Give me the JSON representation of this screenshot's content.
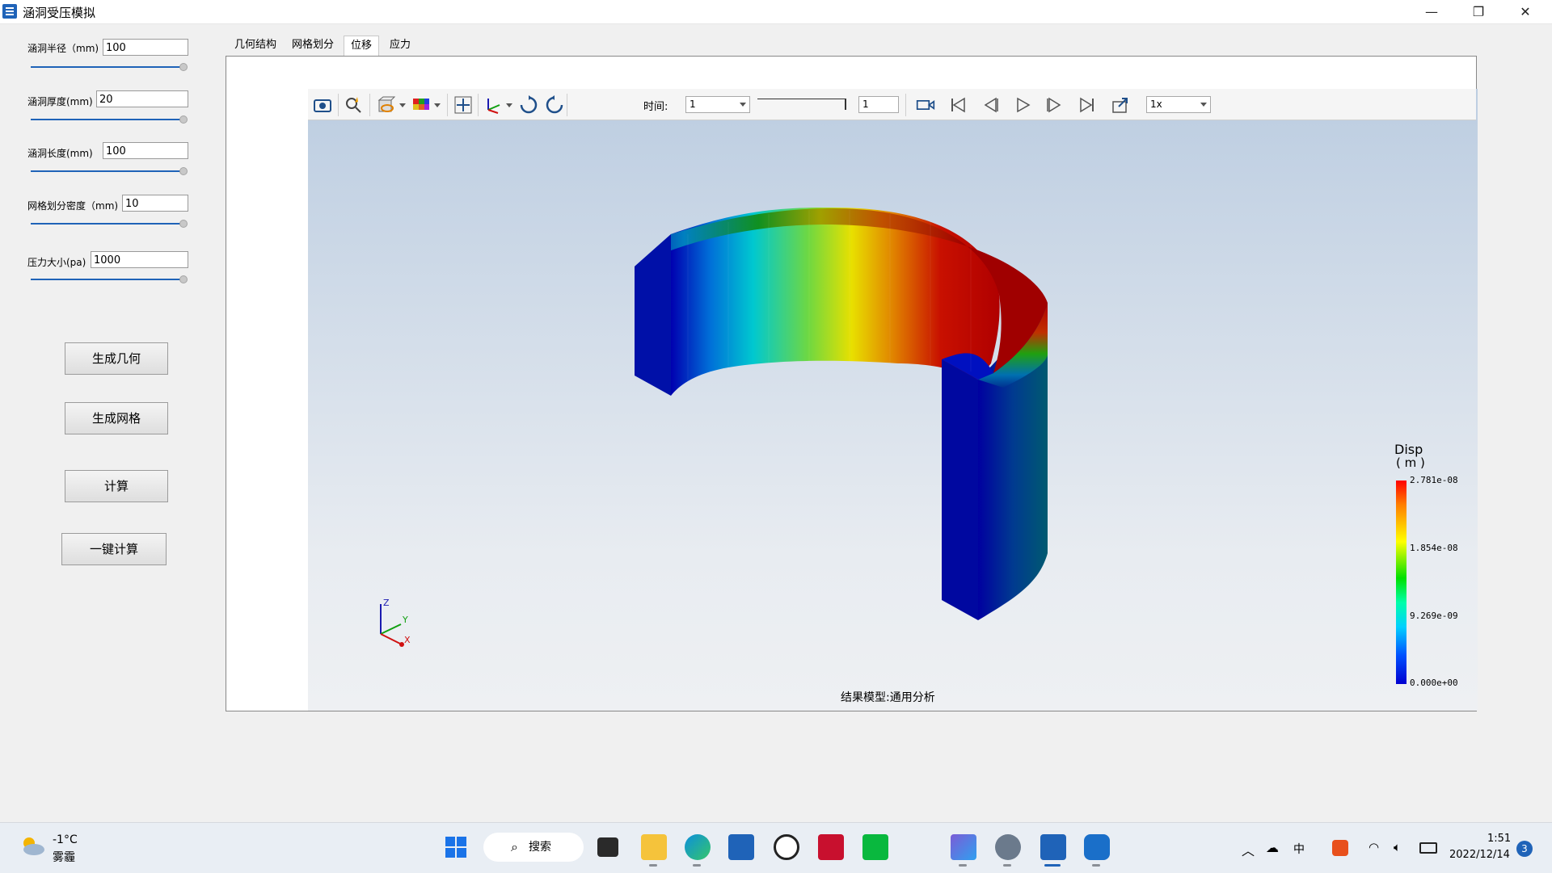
{
  "window": {
    "title": "涵洞受压模拟",
    "minimize": "—",
    "restore": "❐",
    "close": "✕"
  },
  "params": [
    {
      "label": "涵洞半径（mm)",
      "value": "100"
    },
    {
      "label": "涵洞厚度(mm)",
      "value": "20"
    },
    {
      "label": "涵洞长度(mm)",
      "value": "100"
    },
    {
      "label": "网格划分密度（mm)",
      "value": "10"
    },
    {
      "label": "压力大小(pa)",
      "value": "1000"
    }
  ],
  "buttons": {
    "geometry": "生成几何",
    "mesh": "生成网格",
    "compute": "计算",
    "one_click": "一键计算"
  },
  "tabs": [
    {
      "label": "几何结构"
    },
    {
      "label": "网格划分"
    },
    {
      "label": "位移",
      "active": true
    },
    {
      "label": "应力"
    }
  ],
  "viewer": {
    "time_label": "时间:",
    "time_value": "1",
    "frame_value": "1",
    "speed_value": "1x",
    "result_caption": "结果模型:通用分析",
    "icons": [
      "camera-icon",
      "zoom-icon",
      "display-mode-icon",
      "color-map-icon",
      "fit-view-icon",
      "axes-icon",
      "rotate-cw-icon",
      "rotate-ccw-icon",
      "record-icon",
      "first-frame-icon",
      "prev-frame-icon",
      "play-icon",
      "next-frame-icon",
      "last-frame-icon",
      "export-icon"
    ]
  },
  "legend": {
    "title": "Disp",
    "unit": "( m )",
    "ticks": [
      "2.781e-08",
      "1.854e-08",
      "9.269e-09",
      "0.000e+00"
    ],
    "colors": [
      "#ff0000",
      "#ffff00",
      "#00e000",
      "#00d0ff",
      "#0000d0"
    ]
  },
  "triad": {
    "x": "X",
    "y": "Y",
    "z": "Z"
  },
  "taskbar": {
    "weather_temp": "-1°C",
    "weather_desc": "雾霾",
    "search_label": "搜索",
    "time": "1:51",
    "date": "2022/12/14",
    "ime": "中",
    "notifications": "3"
  }
}
